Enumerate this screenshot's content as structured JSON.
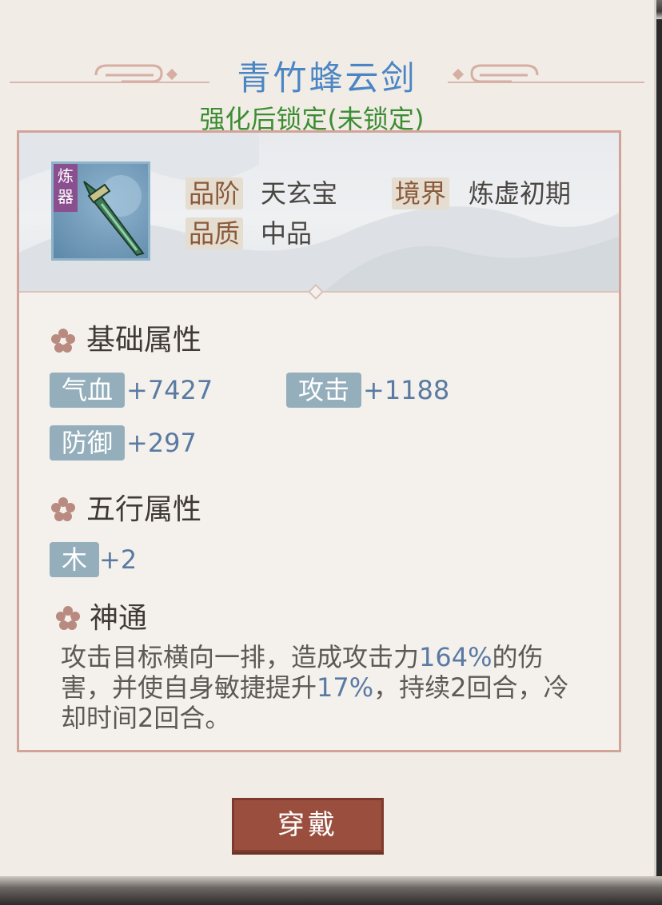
{
  "item": {
    "name": "青竹蜂云剑",
    "lock_status": "强化后锁定(未锁定)",
    "refine_badge": "炼 器",
    "icon": "jade-sword-icon"
  },
  "info": {
    "grade_label": "品阶",
    "grade_value": "天玄宝",
    "realm_label": "境界",
    "realm_value": "炼虚初期",
    "quality_label": "品质",
    "quality_value": "中品"
  },
  "base_stats": {
    "title": "基础属性",
    "hp_label": "气血",
    "hp_value": "+7427",
    "atk_label": "攻击",
    "atk_value": "+1188",
    "def_label": "防御",
    "def_value": "+297"
  },
  "element_stats": {
    "title": "五行属性",
    "wood_label": "木",
    "wood_value": "+2"
  },
  "skill": {
    "title": "神通",
    "desc_1": "攻击目标横向一排，造成攻击力",
    "pct_1": "164%",
    "desc_2": "的伤害，并使自身敏捷提升",
    "pct_2": "17%",
    "desc_3": "，持续",
    "dur": "2",
    "desc_4": "回合，冷却时间",
    "cd": "2",
    "desc_5": "回合。"
  },
  "actions": {
    "equip_label": "穿戴"
  },
  "colors": {
    "title": "#4b86c4",
    "lock_status": "#3c8d32",
    "stat_value": "#5a7aa2",
    "button": "#9a4f3e",
    "panel_border": "#d2a398"
  }
}
